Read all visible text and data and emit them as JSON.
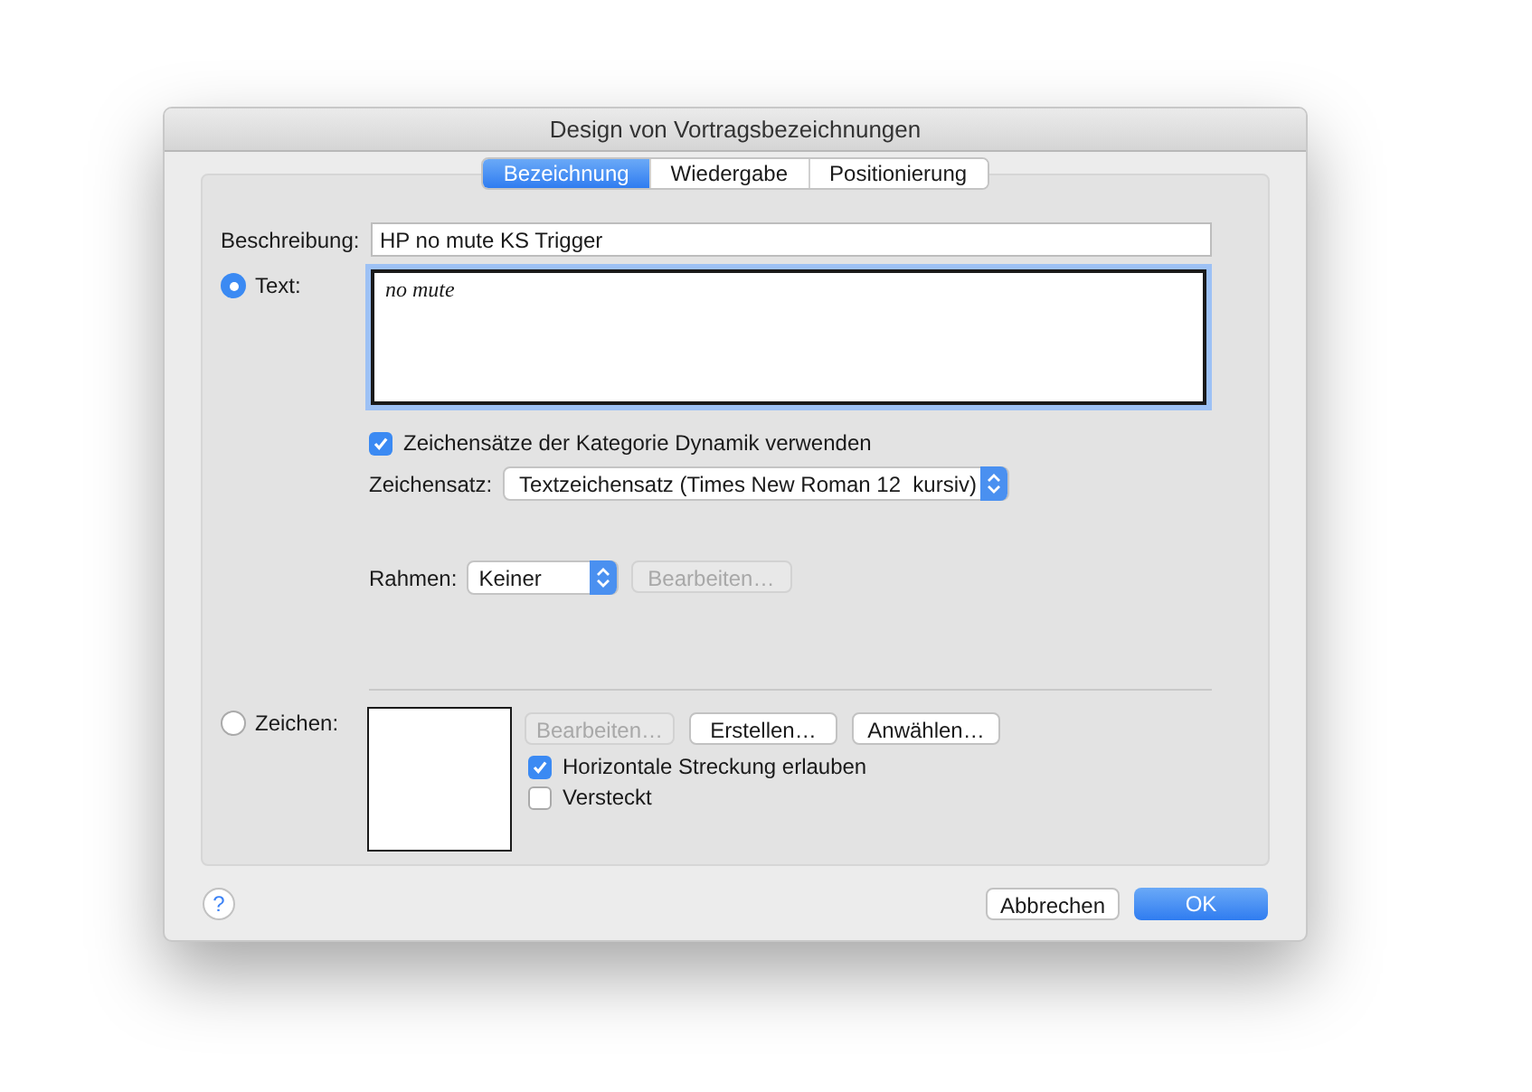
{
  "window": {
    "title": "Design von Vortragsbezeichnungen"
  },
  "tabs": [
    {
      "label": "Bezeichnung",
      "selected": true
    },
    {
      "label": "Wiedergabe",
      "selected": false
    },
    {
      "label": "Positionierung",
      "selected": false
    }
  ],
  "description": {
    "label": "Beschreibung:",
    "value": "HP no mute KS Trigger"
  },
  "mode_options": [
    {
      "label": "Text:",
      "selected": true
    },
    {
      "label": "Zeichen:",
      "selected": false
    }
  ],
  "text_content": "no mute",
  "dynamic_fonts": {
    "label": "Zeichensätze der Kategorie Dynamik verwenden",
    "checked": true
  },
  "font": {
    "label": "Zeichensatz:",
    "value": "Textzeichensatz (Times New Roman 12  kursiv)"
  },
  "frame": {
    "label": "Rahmen:",
    "value": "Keiner",
    "button": {
      "label": "Bearbeiten…",
      "disabled": true
    }
  },
  "symbol_buttons": [
    {
      "label": "Bearbeiten…",
      "disabled": true
    },
    {
      "label": "Erstellen…",
      "disabled": false
    },
    {
      "label": "Anwählen…",
      "disabled": false
    }
  ],
  "symbol_options": [
    {
      "label": "Horizontale Streckung erlauben",
      "checked": true
    },
    {
      "label": "Versteckt",
      "checked": false
    }
  ],
  "help_button": "?",
  "buttons": [
    {
      "label": "Abbrechen",
      "default": false
    },
    {
      "label": "OK",
      "default": true
    }
  ]
}
